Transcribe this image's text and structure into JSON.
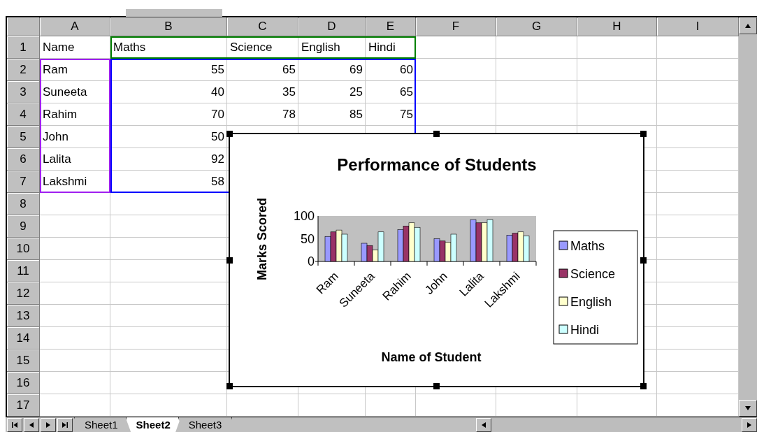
{
  "column_headers": [
    "A",
    "B",
    "C",
    "D",
    "E",
    "F",
    "G",
    "H",
    "I"
  ],
  "rows": [
    {
      "header": "1",
      "cells": [
        {
          "text": "Name",
          "kind": "label"
        },
        {
          "text": "Maths",
          "kind": "label"
        },
        {
          "text": "Science",
          "kind": "label"
        },
        {
          "text": "English",
          "kind": "label"
        },
        {
          "text": "Hindi",
          "kind": "label"
        }
      ]
    },
    {
      "header": "2",
      "cells": [
        {
          "text": "Ram",
          "kind": "label"
        },
        {
          "text": "55",
          "kind": "number"
        },
        {
          "text": "65",
          "kind": "number"
        },
        {
          "text": "69",
          "kind": "number"
        },
        {
          "text": "60",
          "kind": "number"
        }
      ]
    },
    {
      "header": "3",
      "cells": [
        {
          "text": "Suneeta",
          "kind": "label"
        },
        {
          "text": "40",
          "kind": "number"
        },
        {
          "text": "35",
          "kind": "number"
        },
        {
          "text": "25",
          "kind": "number"
        },
        {
          "text": "65",
          "kind": "number"
        }
      ]
    },
    {
      "header": "4",
      "cells": [
        {
          "text": "Rahim",
          "kind": "label"
        },
        {
          "text": "70",
          "kind": "number"
        },
        {
          "text": "78",
          "kind": "number"
        },
        {
          "text": "85",
          "kind": "number"
        },
        {
          "text": "75",
          "kind": "number"
        }
      ]
    },
    {
      "header": "5",
      "cells": [
        {
          "text": "John",
          "kind": "label"
        },
        {
          "text": "50",
          "kind": "number"
        }
      ]
    },
    {
      "header": "6",
      "cells": [
        {
          "text": "Lalita",
          "kind": "label"
        },
        {
          "text": "92",
          "kind": "number"
        }
      ]
    },
    {
      "header": "7",
      "cells": [
        {
          "text": "Lakshmi",
          "kind": "label"
        },
        {
          "text": "58",
          "kind": "number"
        }
      ]
    },
    {
      "header": "8"
    },
    {
      "header": "9"
    },
    {
      "header": "10"
    },
    {
      "header": "11"
    },
    {
      "header": "12"
    },
    {
      "header": "13"
    },
    {
      "header": "14"
    },
    {
      "header": "15"
    },
    {
      "header": "16"
    },
    {
      "header": "17"
    }
  ],
  "chart": {
    "chart_data": {
      "type": "bar",
      "title": "Performance of Students",
      "xlabel": "Name of Student",
      "ylabel": "Marks Scored",
      "categories": [
        "Ram",
        "Suneeta",
        "Rahim",
        "John",
        "Lalita",
        "Lakshmi"
      ],
      "series": [
        {
          "name": "Maths",
          "color": "#9999ff",
          "values": [
            55,
            40,
            70,
            50,
            92,
            58
          ]
        },
        {
          "name": "Science",
          "color": "#993366",
          "values": [
            65,
            35,
            78,
            45,
            85,
            62
          ]
        },
        {
          "name": "English",
          "color": "#ffffcc",
          "values": [
            69,
            25,
            85,
            42,
            85,
            65
          ]
        },
        {
          "name": "Hindi",
          "color": "#ccffff",
          "values": [
            60,
            65,
            75,
            60,
            92,
            56
          ]
        }
      ],
      "ylim": [
        0,
        100
      ],
      "yticks": [
        0,
        50,
        100
      ],
      "legend": "right"
    }
  },
  "sheet_tabs": [
    {
      "label": "Sheet1",
      "selected": false
    },
    {
      "label": "Sheet2",
      "selected": true
    },
    {
      "label": "Sheet3",
      "selected": false
    }
  ]
}
